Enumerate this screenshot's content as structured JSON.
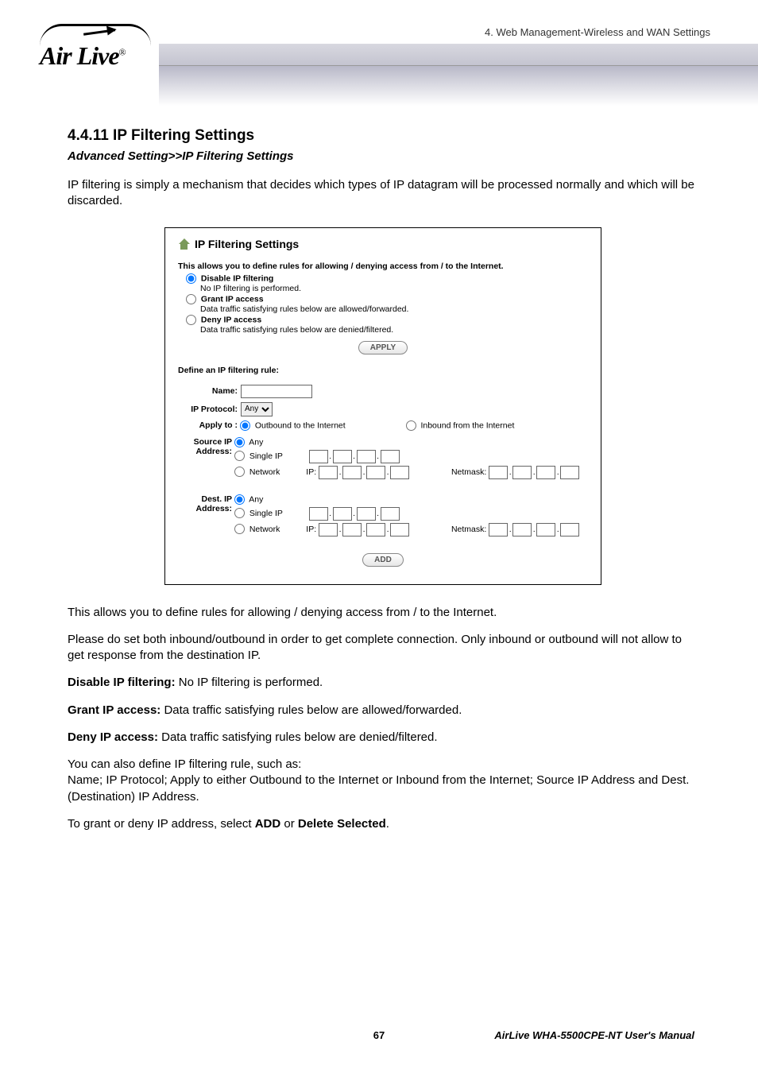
{
  "header": {
    "chapter_text": "4. Web Management-Wireless and WAN Settings",
    "logo_text": "Air Live",
    "logo_reg": "®"
  },
  "section": {
    "number_title": "4.4.11 IP Filtering Settings",
    "breadcrumb": "Advanced Setting>>IP Filtering Settings",
    "intro": "IP filtering is simply a mechanism that decides which types of IP datagram will be processed normally and which will be discarded."
  },
  "panel": {
    "title": "IP Filtering Settings",
    "description": "This allows you to define rules for allowing / denying access from / to the Internet.",
    "modes": {
      "disable": {
        "label": "Disable IP filtering",
        "sub": "No IP filtering is performed."
      },
      "grant": {
        "label": "Grant IP access",
        "sub": "Data traffic satisfying rules below are allowed/forwarded."
      },
      "deny": {
        "label": "Deny IP access",
        "sub": "Data traffic satisfying rules below are denied/filtered."
      }
    },
    "apply_btn": "APPLY",
    "define_heading": "Define an IP filtering rule:",
    "form": {
      "name_label": "Name:",
      "protocol_label": "IP Protocol:",
      "protocol_value": "Any",
      "applyto_label": "Apply to :",
      "applyto_out": "Outbound to the Internet",
      "applyto_in": "Inbound from the Internet",
      "source_label": "Source IP Address:",
      "dest_label": "Dest. IP Address:",
      "opt_any": "Any",
      "opt_single": "Single IP",
      "opt_network": "Network",
      "ip_label": "IP:",
      "netmask_label": "Netmask:"
    },
    "add_btn": "ADD"
  },
  "body": {
    "p1": "This allows you to define rules for allowing / denying access from / to the Internet.",
    "p2": "Please do set both inbound/outbound in order to get complete connection. Only inbound or outbound will not allow to get response from the destination IP.",
    "p3_bold": "Disable IP filtering:",
    "p3_rest": " No IP filtering is performed.",
    "p4_bold": "Grant IP access:",
    "p4_rest": " Data traffic satisfying rules below are allowed/forwarded.",
    "p5_bold": "Deny IP access:",
    "p5_rest": " Data traffic satisfying rules below are denied/filtered.",
    "p6a": "You can also define IP filtering rule, such as:",
    "p6b": "Name; IP Protocol; Apply to either Outbound to the Internet or Inbound from the Internet; Source IP Address and Dest. (Destination) IP Address.",
    "p7a": "To grant or deny IP address, select ",
    "p7_add": "ADD",
    "p7_mid": " or ",
    "p7_del": "Delete Selected",
    "p7_end": "."
  },
  "footer": {
    "page": "67",
    "manual": "AirLive WHA-5500CPE-NT User's Manual"
  }
}
